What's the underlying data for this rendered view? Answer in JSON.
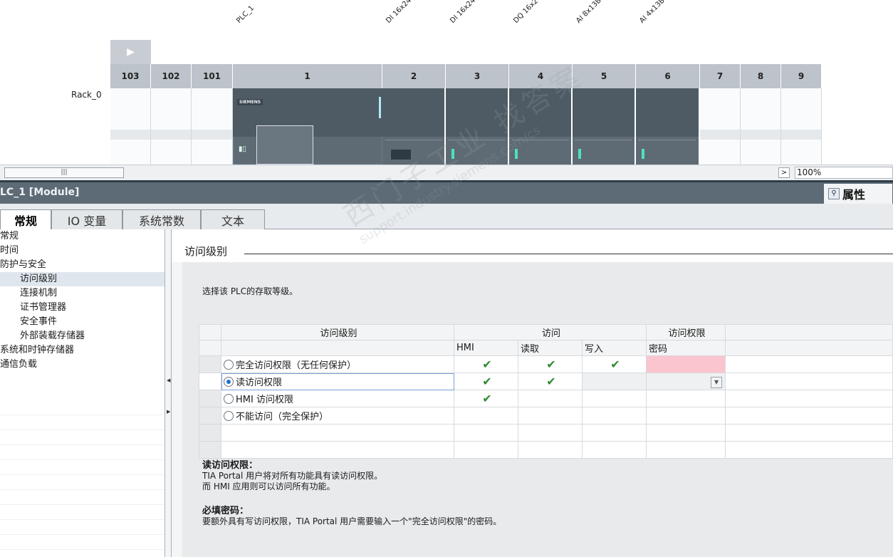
{
  "device_view": {
    "device_labels": [
      "PLC_1",
      "DI 16x24",
      "DI 16x24",
      "DQ 16x2",
      "AI 8x13B",
      "AI 4x13B"
    ],
    "expand_icon": "triangle-right-icon",
    "slots": [
      "103",
      "102",
      "101",
      "1",
      "2",
      "3",
      "4",
      "5",
      "6",
      "7",
      "8",
      "9"
    ],
    "rack_label": "Rack_0",
    "cpu_brand": "SIEMENS",
    "zoom": "100%",
    "scroll_thumb_glyph": "|||",
    "scroll_arrow_icon": "chevron-right-icon"
  },
  "properties": {
    "module_title": "LC_1 [Module]",
    "properties_tab_label": "属性",
    "properties_tab_icon": "magnifier-icon",
    "tabs": [
      "常规",
      "IO 变量",
      "系统常数",
      "文本"
    ],
    "active_tab": "常规",
    "nav": {
      "items": [
        {
          "label": "常规",
          "indent": false
        },
        {
          "label": "时间",
          "indent": false
        },
        {
          "label": "防护与安全",
          "indent": false
        },
        {
          "label": "访问级别",
          "indent": true
        },
        {
          "label": "连接机制",
          "indent": true
        },
        {
          "label": "证书管理器",
          "indent": true
        },
        {
          "label": "安全事件",
          "indent": true
        },
        {
          "label": "外部装载存储器",
          "indent": true
        },
        {
          "label": "系统和时钟存储器",
          "indent": false
        },
        {
          "label": "通信负载",
          "indent": false
        }
      ],
      "selected": "访问级别"
    },
    "section": {
      "title": "访问级别",
      "intro": "选择该 PLC的存取等级。",
      "table": {
        "group_headers": [
          "访问级别",
          "访问",
          "访问权限"
        ],
        "sub_headers": [
          "HMI",
          "读取",
          "写入",
          "密码"
        ],
        "rows": [
          {
            "label": "完全访问权限（无任何保护）",
            "selected": false,
            "hmi": true,
            "read": true,
            "write": true,
            "password": "pink"
          },
          {
            "label": "读访问权限",
            "selected": true,
            "hmi": true,
            "read": true,
            "write": false,
            "password": "dropdown"
          },
          {
            "label": "HMI 访问权限",
            "selected": false,
            "hmi": true,
            "read": false,
            "write": false,
            "password": ""
          },
          {
            "label": "不能访问（完全保护）",
            "selected": false,
            "hmi": false,
            "read": false,
            "write": false,
            "password": ""
          }
        ],
        "check_glyph": "✔"
      },
      "desc": {
        "read_title": "读访问权限：",
        "read_line1": "TIA Portal 用户将对所有功能具有读访问权限。",
        "read_line2": "而 HMI 应用则可以访问所有功能。",
        "pwd_title": "必填密码：",
        "pwd_line1": "要额外具有写访问权限，TIA Portal 用户需要输入一个\"完全访问权限\"的密码。"
      }
    }
  },
  "watermark": {
    "line1": "西门子工业  找答案",
    "line2": "support.industry.siemens.com/cs"
  },
  "colors": {
    "title_bar": "#5d6b77",
    "module_body": "#5f6b74",
    "check_green": "#2e8a2e",
    "password_pink": "#fbc5cf",
    "radio_blue": "#1f6fd0"
  }
}
